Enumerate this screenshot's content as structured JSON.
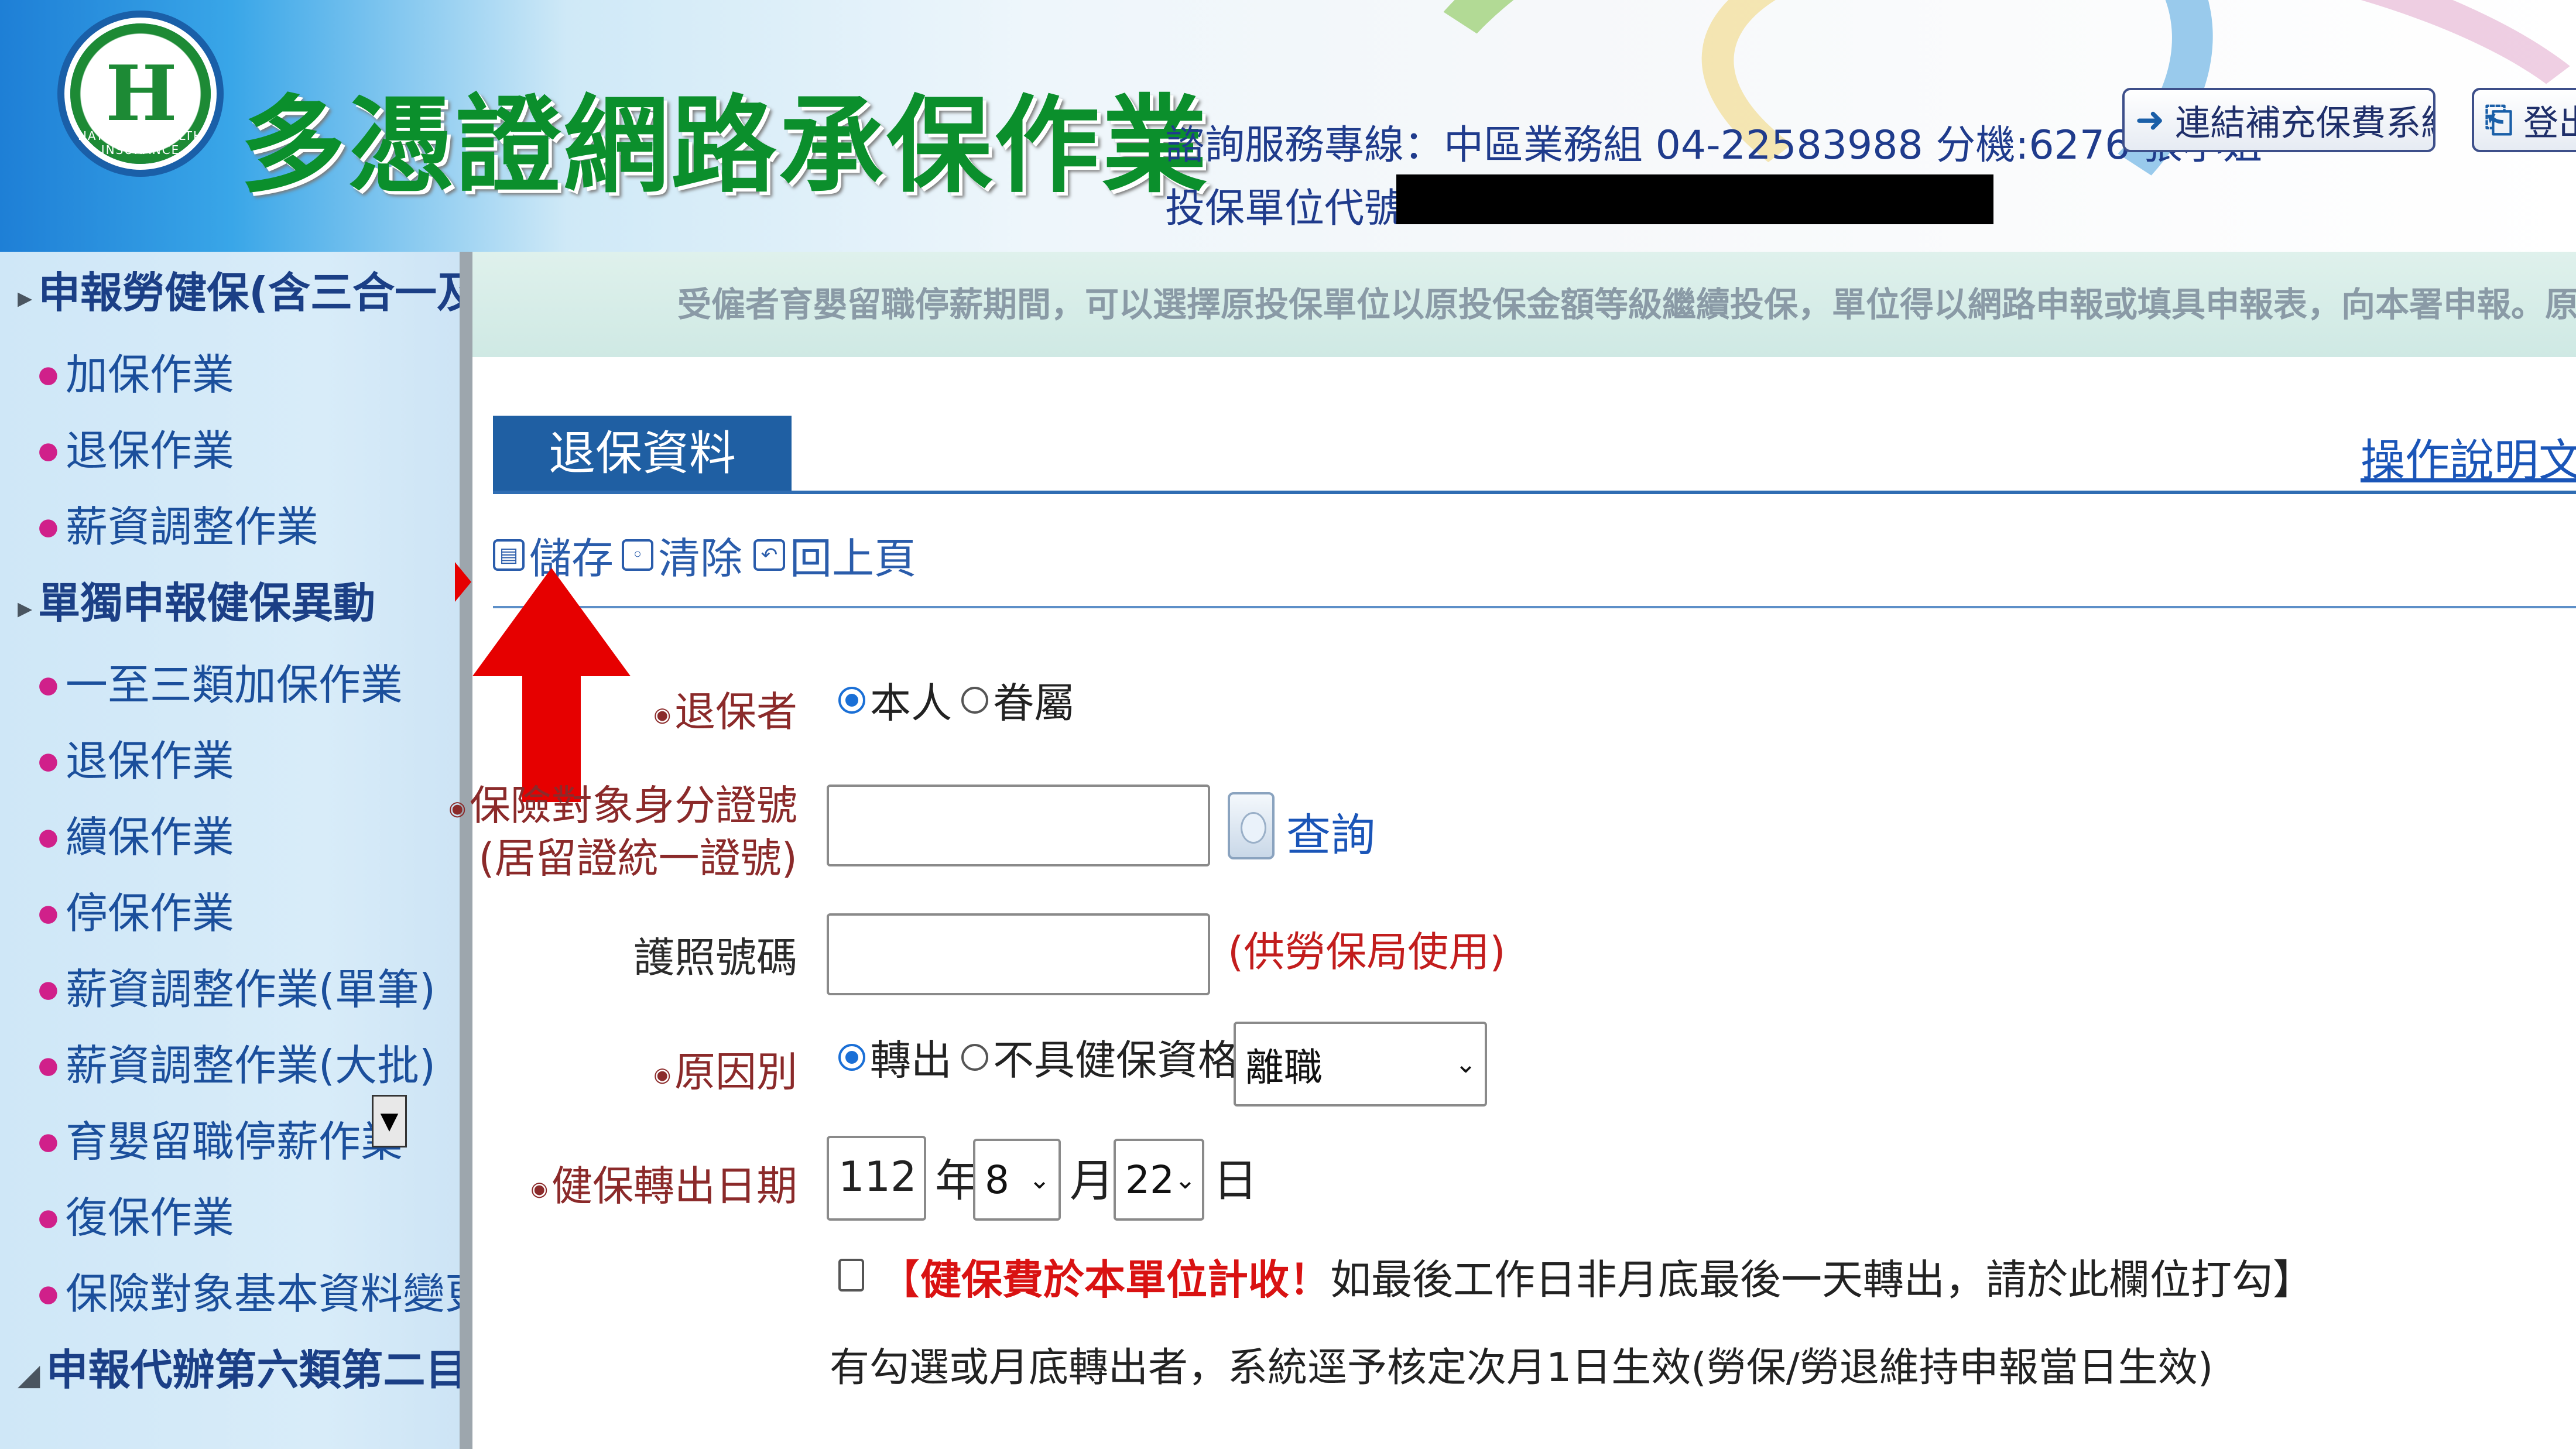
{
  "header": {
    "logo_text": "NATIONAL HEALTH INSURANCE",
    "site_title": "多憑證網路承保作業",
    "contact": "諮詢服務專線：中區業務組  04-22583988 分機:6276 張小姐",
    "unit_label": "投保單位代號：",
    "link_button": "連結補充保費系統",
    "logout_button": "登出"
  },
  "sidebar": {
    "items": [
      {
        "type": "section",
        "label": "申報勞健保(含三合一及二"
      },
      {
        "type": "sub",
        "label": "加保作業"
      },
      {
        "type": "sub",
        "label": "退保作業"
      },
      {
        "type": "sub",
        "label": "薪資調整作業"
      },
      {
        "type": "section",
        "label": "單獨申報健保異動"
      },
      {
        "type": "sub",
        "label": "一至三類加保作業"
      },
      {
        "type": "sub",
        "label": "退保作業"
      },
      {
        "type": "sub",
        "label": "續保作業"
      },
      {
        "type": "sub",
        "label": "停保作業"
      },
      {
        "type": "sub",
        "label": "薪資調整作業(單筆)"
      },
      {
        "type": "sub",
        "label": "薪資調整作業(大批)"
      },
      {
        "type": "sub",
        "label": "育嬰留職停薪作業"
      },
      {
        "type": "sub",
        "label": "復保作業"
      },
      {
        "type": "sub",
        "label": "保險對象基本資料變更"
      },
      {
        "type": "section",
        "label": "申報代辦第六類第二目地區"
      }
    ]
  },
  "content": {
    "marquee": "受僱者育嬰留職停薪期間，可以選擇原投保單位以原投保金額等級繼續投保，單位得以網路申報或填具申報表，向本署申報。原由雇主負擔",
    "tab_title": "退保資料",
    "help_link": "操作說明文件",
    "toolbar": {
      "save": "儲存",
      "clear": "清除",
      "back": "回上頁"
    },
    "form": {
      "withdrawer_label": "退保者",
      "withdrawer_options": [
        "本人",
        "眷屬"
      ],
      "withdrawer_selected": "本人",
      "id_label_line1": "保險對象身分證號",
      "id_label_line2": "(居留證統一證號)",
      "id_value": "",
      "query_label": "查詢",
      "passport_label": "護照號碼",
      "passport_value": "",
      "passport_note": "(供勞保局使用)",
      "reason_label": "原因別",
      "reason_options": [
        "轉出",
        "不具健保資格"
      ],
      "reason_selected": "轉出",
      "reason_select_value": "離職",
      "date_label": "健保轉出日期",
      "year_value": "112",
      "year_unit": "年",
      "month_value": "8",
      "month_unit": "月",
      "day_value": "22",
      "day_unit": "日",
      "notice_open": "【",
      "notice_red": "健保費於本單位計收！",
      "notice_rest": "如最後工作日非月底最後一天轉出，請於此欄位打勾】",
      "notice2": "有勾選或月底轉出者，系統逕予核定次月1日生效(勞保/勞退維持申報當日生效)"
    }
  },
  "colors": {
    "accent": "#1f5fa3",
    "title_green": "#0b8f2c",
    "alert_red": "#d91212",
    "arrow_red": "#e60000"
  }
}
